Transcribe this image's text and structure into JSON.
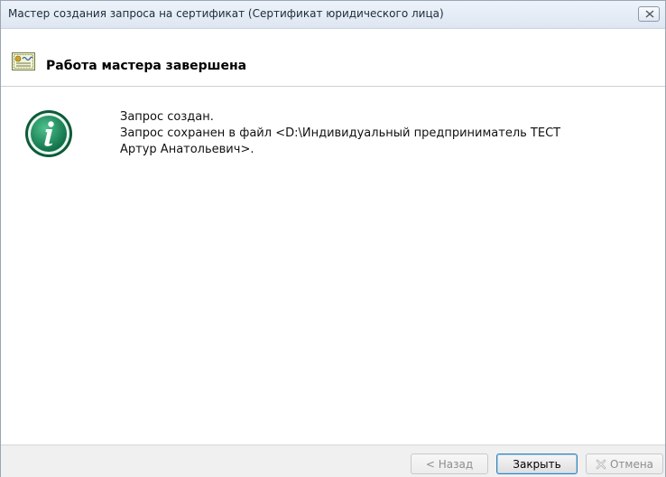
{
  "window": {
    "title": "Мастер создания запроса на сертификат (Сертификат юридического лица)",
    "close_icon": "close-icon"
  },
  "header": {
    "icon": "certificate-icon",
    "title": "Работа мастера завершена"
  },
  "content": {
    "icon": "info-icon",
    "lines": [
      "Запрос создан.",
      "Запрос сохранен в файл <D:\\Индивидуальный предприниматель ТЕСТ",
      "Артур Анатольевич>."
    ]
  },
  "footer": {
    "back_label": "< Назад",
    "close_label": "Закрыть",
    "cancel_label": "Отмена",
    "cancel_icon": "cancel-x-icon"
  },
  "colors": {
    "info_green": "#1f8a5e",
    "default_button_border": "#3c7fb1"
  }
}
